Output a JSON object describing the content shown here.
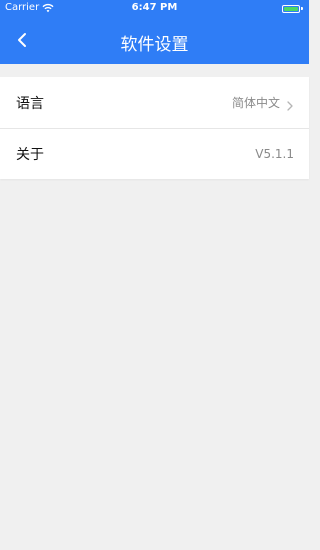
{
  "status_bar": {
    "carrier": "Carrier",
    "time": "6:47 PM",
    "wifi_icon": "wifi-icon",
    "battery_icon": "battery-icon"
  },
  "nav": {
    "title": "软件设置",
    "back_icon": "chevron-left-icon",
    "background_color": "#2f7df6"
  },
  "settings": {
    "items": [
      {
        "label": "语言",
        "value": "简体中文",
        "has_chevron": true
      },
      {
        "label": "关于",
        "value": "V5.1.1",
        "has_chevron": false
      }
    ]
  }
}
